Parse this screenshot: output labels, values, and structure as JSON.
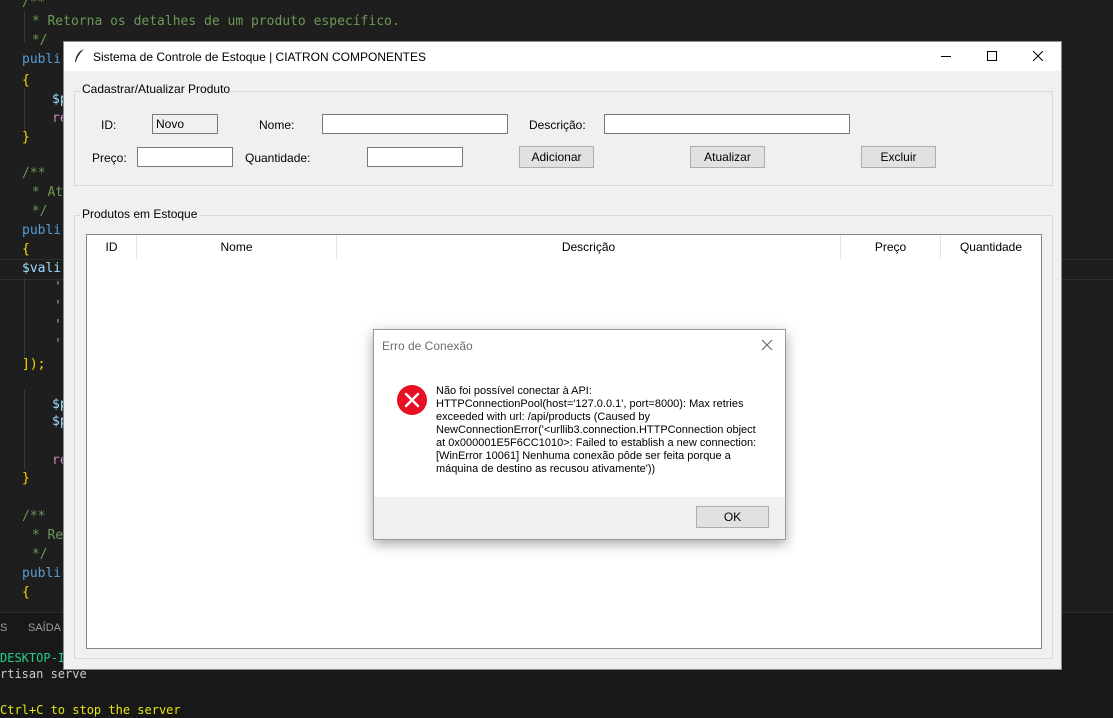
{
  "editor": {
    "comment_1": "/**",
    "comment_2": " * Retorna os detalhes de um produto específico.",
    "comment_3": " */",
    "kw_public_1": "publi",
    "brace_open_1": "{",
    "var_1": "$p",
    "ret_1": "re",
    "brace_close_1": "}",
    "comment_4": "/**",
    "comment_5": " * At",
    "comment_6": " */",
    "kw_public_2": "publi",
    "brace_open_2": "{",
    "var_valid": "$vali",
    "str_1": "'",
    "str_2": "'",
    "str_3": "'",
    "str_4": "'",
    "close_array": "]);",
    "var_2": "$p",
    "var_3": "$p",
    "ret_2": "re",
    "brace_close_2": "}",
    "comment_7": "/**",
    "comment_8": " * Re",
    "comment_9": " */",
    "kw_public_3": "publi",
    "brace_open_3": "{"
  },
  "panel": {
    "tab_problems": "S",
    "tab_output": "SAÍDA",
    "term_host": "DESKTOP-I",
    "term_cmd": "rtisan serve",
    "term_hint": "Ctrl+C to stop the server"
  },
  "window": {
    "title": "Sistema de Controle de Estoque | CIATRON COMPONENTES",
    "form_frame_title": "Cadastrar/Atualizar Produto",
    "label_id": "ID:",
    "id_value": "Novo",
    "label_nome": "Nome:",
    "nome_value": "",
    "label_descricao": "Descrição:",
    "descricao_value": "",
    "label_preco": "Preço:",
    "preco_value": "",
    "label_quantidade": "Quantidade:",
    "quantidade_value": "",
    "btn_adicionar": "Adicionar",
    "btn_atualizar": "Atualizar",
    "btn_excluir": "Excluir",
    "list_frame_title": "Produtos em Estoque",
    "columns": [
      "ID",
      "Nome",
      "Descrição",
      "Preço",
      "Quantidade"
    ]
  },
  "dialog": {
    "title": "Erro de Conexão",
    "message": "Não foi possível conectar à API: HTTPConnectionPool(host='127.0.0.1', port=8000): Max retries exceeded with url: /api/products (Caused by NewConnectionError('<urllib3.connection.HTTPConnection object at 0x000001E5F6CC1010>: Failed to establish a new connection: [WinError 10061] Nenhuma conexão pôde ser feita porque a máquina de destino as recusou ativamente'))",
    "ok_label": "OK",
    "icon": "error-icon"
  },
  "colors": {
    "error_red": "#e81123",
    "editor_bg": "#1e1e1e",
    "window_bg": "#f0f0f0"
  }
}
